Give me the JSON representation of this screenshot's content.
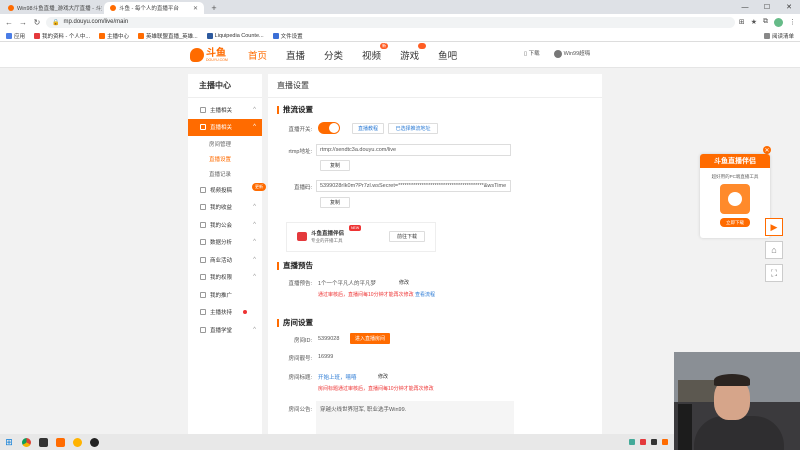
{
  "browser": {
    "tabs": [
      {
        "label": "Win98斗鱼直播_游戏大厅直播 - 斗鱼",
        "active": false
      },
      {
        "label": "斗鱼 - 每个人的直播平台",
        "active": true
      }
    ],
    "url": "mp.douyu.com/live/main",
    "bookmarks": [
      {
        "label": "应用"
      },
      {
        "label": "我的资料 - 个人中..."
      },
      {
        "label": "主播中心"
      },
      {
        "label": "英雄联盟直播_英雄..."
      },
      {
        "label": "Liquipedia Counte..."
      },
      {
        "label": "文件设置"
      }
    ],
    "reading_list": "阅读清单"
  },
  "site": {
    "logo_text": "斗鱼",
    "logo_sub": "DOUYU.COM",
    "nav": [
      "首页",
      "直播",
      "分类",
      "视频",
      "游戏",
      "鱼吧"
    ],
    "nav_badge": "新",
    "download": "下载",
    "username": "Win99超嗨"
  },
  "sidebar": {
    "title": "主播中心",
    "items": [
      {
        "label": "主播相关"
      },
      {
        "label": "直播相关"
      },
      {
        "label": "房间管理"
      },
      {
        "label": "直播设置"
      },
      {
        "label": "直播记录"
      },
      {
        "label": "视频投稿"
      },
      {
        "label": "我的收益"
      },
      {
        "label": "我的公会"
      },
      {
        "label": "数据分析"
      },
      {
        "label": "商业活动"
      },
      {
        "label": "我的权限"
      },
      {
        "label": "我的推广"
      },
      {
        "label": "主播扶持"
      },
      {
        "label": "直播学堂"
      }
    ],
    "new_tag": "更新"
  },
  "main": {
    "title": "直播设置",
    "stream": {
      "section": "推流设置",
      "switch_label": "直播开关:",
      "btn_tutorial": "直播教程",
      "btn_third": "已选择推流地址",
      "rtmp_label": "rtmp地址:",
      "rtmp_value": "rtmp://sendtc3a.douyu.com/live",
      "copy1": "复制",
      "code_label": "直播码:",
      "code_value": "5399028rIk0m?Pr7zl.wsSecret=****************************************&wsTime",
      "copy2": "复制"
    },
    "promo": {
      "title": "斗鱼直播伴侣",
      "sub": "专业的开播工具",
      "new": "NEW",
      "download": "前往下载"
    },
    "preview": {
      "section": "直播预告",
      "label": "直播预告:",
      "value": "1个一个平凡人的平凡梦",
      "edit": "修改",
      "warn": "通过审核后，直播间每10分钟才能再次修改",
      "link": "查看流程"
    },
    "room": {
      "section": "房间设置",
      "id_label": "房间ID:",
      "id_value": "5399028",
      "enter_btn": "进入直播房间",
      "num_label": "房间靓号:",
      "num_value": "16999",
      "title_label": "房间标题:",
      "title_value": "开始上班，嘻嘻",
      "title_edit": "修改",
      "title_warn": "房间标题通过审核后，直播间每10分钟才能再次修改",
      "notice_label": "房间公告:",
      "notice_value": "穿越火线世界冠军, 职业选手Win99."
    }
  },
  "float": {
    "title": "斗鱼直播伴侣",
    "sub": "超好用的PC端直播工具",
    "btn": "立即下载"
  },
  "colors": {
    "accent": "#ff6b00",
    "link": "#2a7ad5",
    "warning": "#e33333"
  }
}
